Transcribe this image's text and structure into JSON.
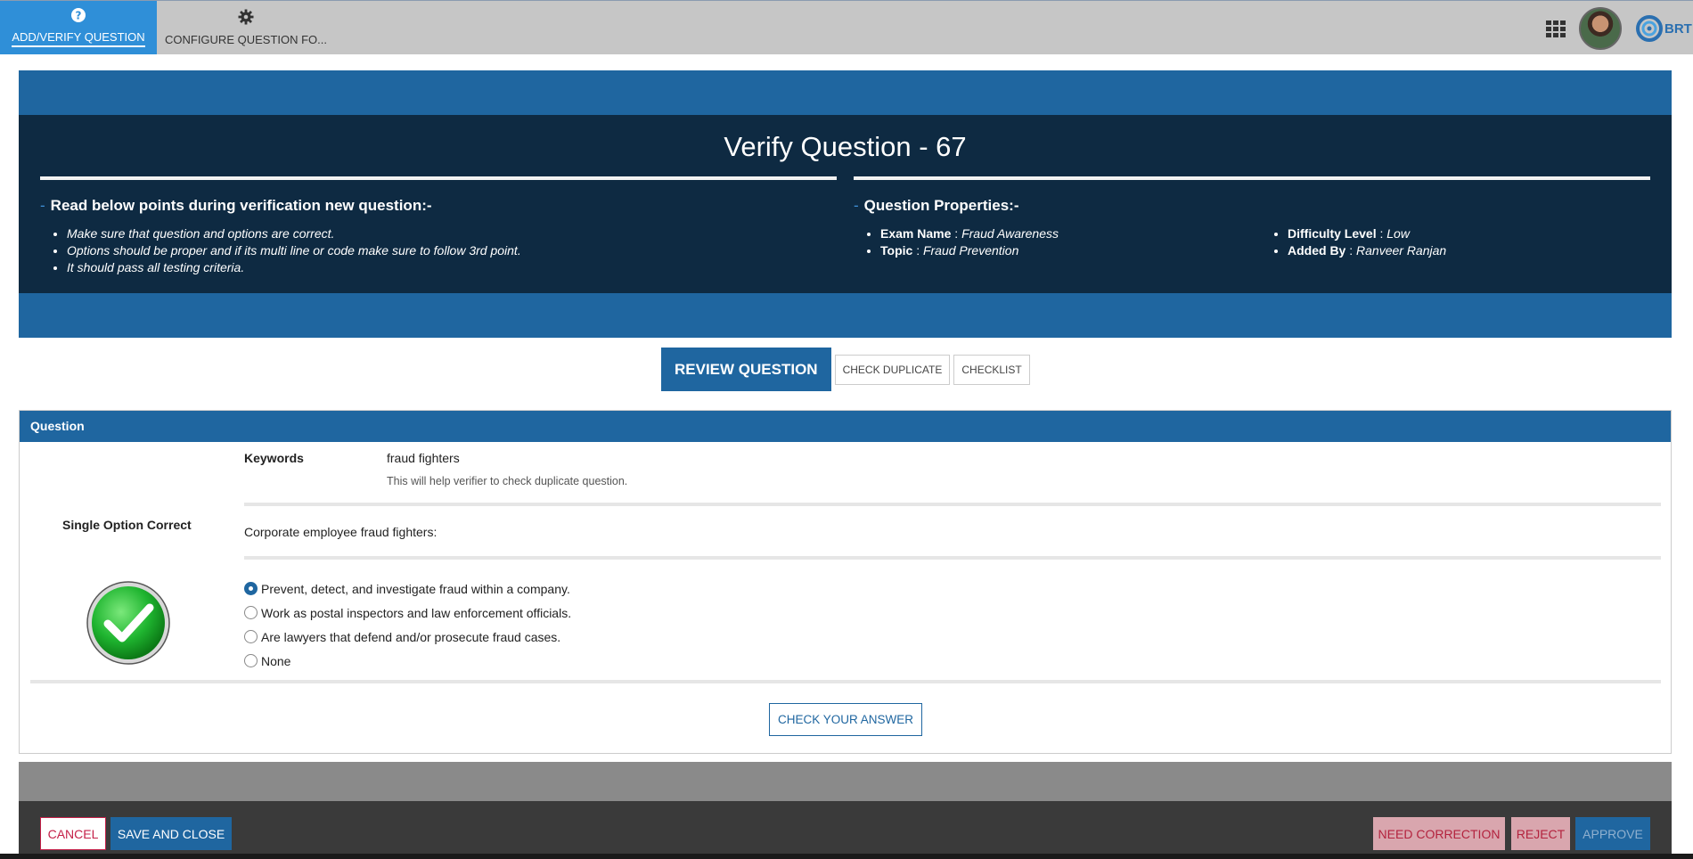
{
  "nav": {
    "tabs": [
      {
        "label": "ADD/VERIFY QUESTION",
        "icon": "help-circle-icon",
        "active": true
      },
      {
        "label": "CONFIGURE QUESTION FO...",
        "icon": "gear-icon",
        "active": false
      }
    ],
    "brand": "BRT"
  },
  "banner": {
    "title": "Verify Question - 67",
    "points_heading": "Read below points during verification new question:-",
    "points": [
      "Make sure that question and options are correct.",
      "Options should be proper and if its multi line or code make sure to follow 3rd point.",
      "It should pass all testing criteria."
    ],
    "properties_heading": "Question Properties:-",
    "properties": [
      {
        "label": "Exam Name",
        "value": "Fraud Awareness"
      },
      {
        "label": "Topic",
        "value": "Fraud Prevention"
      },
      {
        "label": "Difficulty Level",
        "value": "Low"
      },
      {
        "label": "Added By",
        "value": "Ranveer Ranjan"
      }
    ],
    "separator": ":"
  },
  "tabs": {
    "review": "REVIEW QUESTION",
    "duplicate": "CHECK DUPLICATE",
    "checklist": "CHECKLIST"
  },
  "question": {
    "header": "Question",
    "type": "Single Option Correct",
    "keywords_label": "Keywords",
    "keywords_value": "fraud fighters",
    "keywords_hint": "This will help verifier to check duplicate question.",
    "text": "Corporate employee fraud fighters:",
    "options": [
      {
        "label": "Prevent, detect, and investigate fraud within a company.",
        "selected": true
      },
      {
        "label": "Work as postal inspectors and law enforcement officials.",
        "selected": false
      },
      {
        "label": "Are lawyers that defend and/or prosecute fraud cases.",
        "selected": false
      },
      {
        "label": "None",
        "selected": false
      }
    ],
    "check_answer": "CHECK YOUR ANSWER"
  },
  "footer": {
    "cancel": "CANCEL",
    "save_close": "SAVE AND CLOSE",
    "need_correction": "NEED CORRECTION",
    "reject": "REJECT",
    "approve": "APPROVE"
  },
  "colors": {
    "primary": "#1f66a0",
    "banner_dark": "#0e2a42",
    "nav_active": "#2f8fd8",
    "danger": "#c42048",
    "success": "#22b14c"
  }
}
